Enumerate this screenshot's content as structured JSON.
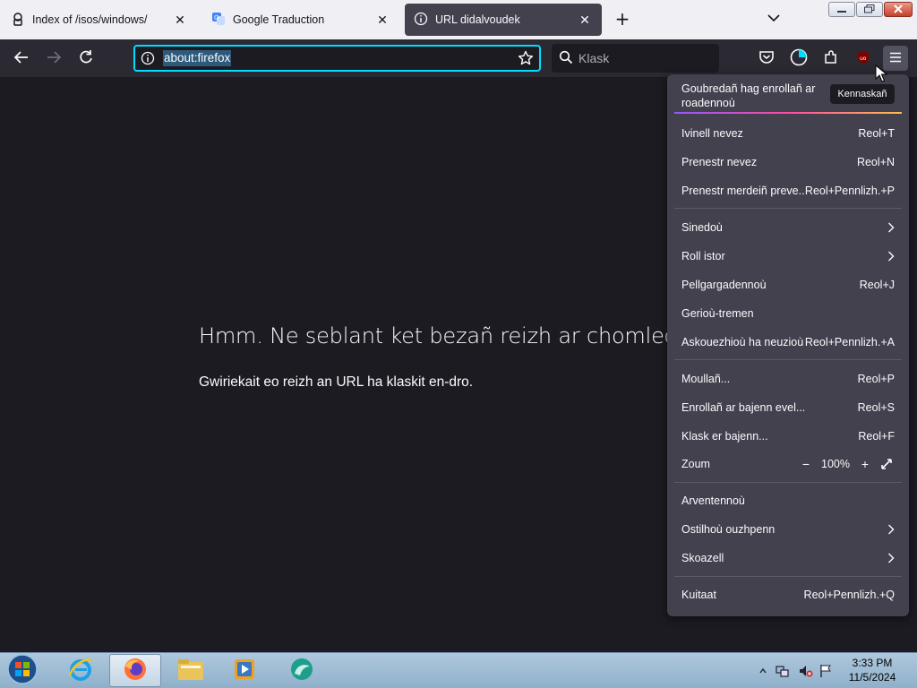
{
  "tabs": [
    {
      "title": "Index of /isos/windows/",
      "icon": "page-icon",
      "active": false
    },
    {
      "title": "Google Traduction",
      "icon": "google-translate-icon",
      "active": false
    },
    {
      "title": "URL didalvoudek",
      "icon": "info-icon",
      "active": true
    }
  ],
  "urlbar": {
    "value": "about:firefox"
  },
  "searchbar": {
    "placeholder": "Klask"
  },
  "error": {
    "title": "Hmm. Ne seblant ket bezañ reizh ar chomlec’h-",
    "description": "Gwiriekait eo reizh an URL ha klaskit en-dro."
  },
  "menu": {
    "header": "Goubredañ hag enrollañ ar roadennoù",
    "header_button": "Kennaskañ",
    "items": [
      {
        "label": "Ivinell nevez",
        "shortcut": "Reol+T"
      },
      {
        "label": "Prenestr nevez",
        "shortcut": "Reol+N"
      },
      {
        "label": "Prenestr merdeiñ preve...",
        "shortcut": "Reol+Pennlizh.+P"
      },
      {
        "label": "Sinedoù",
        "shortcut": ""
      },
      {
        "label": "Roll istor",
        "shortcut": ""
      },
      {
        "label": "Pellgargadennoù",
        "shortcut": "Reol+J"
      },
      {
        "label": "Gerioù-tremen",
        "shortcut": ""
      },
      {
        "label": "Askouezhioù ha neuzioù",
        "shortcut": "Reol+Pennlizh.+A"
      },
      {
        "label": "Moullañ...",
        "shortcut": "Reol+P"
      },
      {
        "label": "Enrollañ ar bajenn evel...",
        "shortcut": "Reol+S"
      },
      {
        "label": "Klask er bajenn...",
        "shortcut": "Reol+F"
      },
      {
        "label": "Zoum",
        "shortcut": ""
      },
      {
        "label": "Arventennoù",
        "shortcut": ""
      },
      {
        "label": "Ostilhoù ouzhpenn",
        "shortcut": ""
      },
      {
        "label": "Skoazell",
        "shortcut": ""
      },
      {
        "label": "Kuitaat",
        "shortcut": "Reol+Pennlizh.+Q"
      }
    ],
    "zoom": {
      "value": "100%",
      "minus": "−",
      "plus": "+"
    }
  },
  "taskbar": {
    "time": "3:33 PM",
    "date": "11/5/2024",
    "apps": [
      "start-orb-icon",
      "internet-explorer-icon",
      "firefox-icon",
      "file-explorer-icon",
      "media-player-icon",
      "app-icon"
    ]
  },
  "colors": {
    "accent": "#00ddff",
    "panel": "#42414d",
    "page": "#1c1b22",
    "toolbar": "#2b2a33",
    "tabstrip": "#f0f0f4"
  }
}
